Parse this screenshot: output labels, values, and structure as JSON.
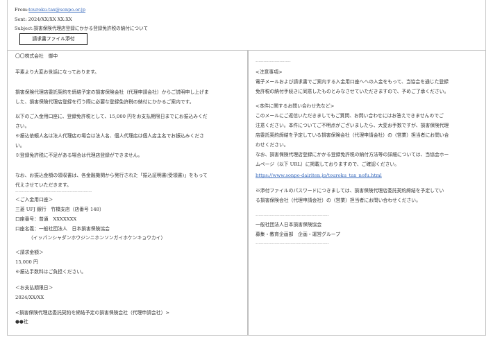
{
  "email": {
    "from_label": "From:",
    "from_address": "touroku-tax@sonpo.or.jp",
    "sent": "Sent: 2024/XX/XX XX:XX",
    "subject": "Subject:損害保険代理店登録にかかる登録免許税の納付について",
    "attachment_button": "請求書ファイル添付"
  },
  "left_body": {
    "addressee": "〇〇株式会社　御中",
    "greeting": "平素より大変お世話になっております。",
    "p1_l1": "損害保険代理店委託契約を締結予定の損害保険会社（代理申請会社）からご説明申し上げま",
    "p1_l2": "した、損害保険代理店登録を行う際に必要な登録免許税の納付にかかるご案内です。",
    "p2_l1": "以下のご入金用口座に、登録免許税として、15,000 円をお支払期限日までにお振込みくだ",
    "p2_l2": "さい。",
    "note1_l1": "※振込依頼人名は法人代理店の場合は法人名、個人代理店は個人店主名でお振込みくださ",
    "note1_l2": "い。",
    "note2": "※登録免許税に不足がある場合は代理店登録ができません。",
    "receipt_l1": "なお、お振込金額の領収書は、各金融機関から発行された「振込証明書(受領書)」をもって",
    "receipt_l2": "代えさせていただきます。",
    "divider": "------------------------------------------------",
    "account_heading": "＜ご入金用口座＞",
    "bank": "三菱 UFJ 銀行　竹橋支店（店番号 148）",
    "account_no": "口座番号：普通　XXXXXXX",
    "account_name": "口座名義：一般社団法人　日本損害保険協会",
    "account_kana": "（イッパンシャダンホウジンニホンソンガイホケンキョウカイ）",
    "amount_heading": "＜請求金額＞",
    "amount": "15,000 円",
    "fee_note": "※振込手数料はご負担ください。",
    "deadline_heading": "＜お支払期限日＞",
    "deadline": "2024/XX/XX",
    "insurer_heading": "<損害保険代理店委託契約を締結予定の損害保険会社（代理申請会社）>",
    "insurer_name": "●●社"
  },
  "right_body": {
    "divider_top": "----------------------",
    "notice_heading": "<注意事項>",
    "notice_l1": "電子メールおよび請求書でご案内する入金用口座へへの入金をもって、当協会を通じた登録",
    "notice_l2": "免許税の納付手続きに同意したものとみなさせていただきますので、予めご了承ください。",
    "inquiry_heading": "<本件に関するお問い合わせ先など>",
    "inq_l1": "このメールにご返信いただきましてもご質問、お問い合わせにはお答えできませんのでご",
    "inq_l2": "注意ください。本件についてご不明点がございましたら、大変お手数ですが、損害保険代理",
    "inq_l3": "店委託契約締結を予定している損害保険会社（代理申請会社）の（営業）担当者にお問い合",
    "inq_l4": "わせください。",
    "inq_l5": "なお、損害保険代理店登録にかかる登録免許税の納付方法等の詳細については、当協会ホー",
    "inq_l6": "ムページ（以下 URL）に掲載しておりますので、ご確認ください。",
    "url": "https://www.sonpo-dairiten.jp/touroku_tax_nofu.html",
    "pw_l1": "※添付ファイルのパスワードにつきましては、損害保険代理店委託契約締結を予定してい",
    "pw_l2": "る損害保険会社（代理申請会社）の（営業）担当者にお問い合わせください。",
    "sig_divider1": "----------------------------------------------",
    "org": "一般社団法人日本損害保険協会",
    "dept": "募集・教育企画部　企画・運営グループ",
    "sig_divider2": "----------------------------------------------"
  }
}
